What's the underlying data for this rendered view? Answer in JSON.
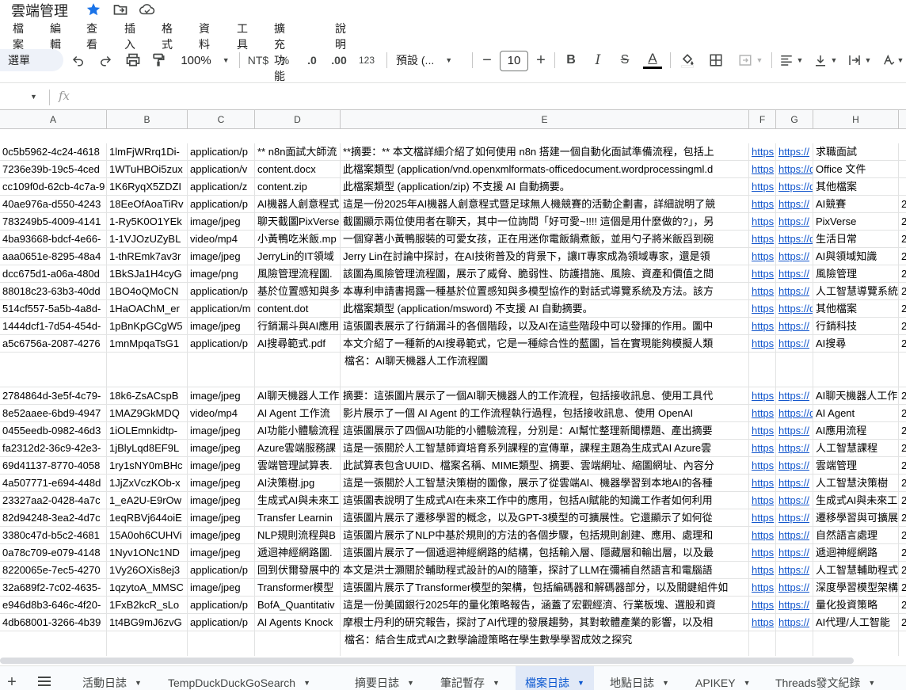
{
  "title": "雲端管理",
  "menu": [
    "檔案",
    "編輯",
    "查看",
    "插入",
    "格式",
    "資料",
    "工具",
    "擴充功能",
    "說明"
  ],
  "toolbar": {
    "search": "選單",
    "zoom": "100%",
    "currency": "NT$",
    "percent": "%",
    "decrease_decimal": ".0",
    "increase_decimal": ".00",
    "number_format": "123",
    "font": "預設 (...",
    "font_size": "10",
    "bold": "B",
    "italic": "I",
    "strike": "S",
    "text_color_label": "A",
    "text_color": "#000000"
  },
  "formula_bar": {
    "fx": "fx",
    "value": ""
  },
  "columns": [
    "A",
    "B",
    "C",
    "D",
    "E",
    "F",
    "G",
    "H"
  ],
  "rows": [
    {
      "a": "0c5b5962-4c24-4618",
      "b": "1lmFjWRrq1Di-",
      "c": "application/p",
      "d": "** n8n面試大師流",
      "e": "**摘要：** 本文檔詳細介紹了如何使用 n8n 搭建一個自動化面試準備流程，包括上",
      "f": "https",
      "g": "https://",
      "h": "求職面試"
    },
    {
      "a": "7236e39b-19c5-4ced",
      "b": "1WTuHBOi5zux",
      "c": "application/v",
      "d": "content.docx",
      "e": "此檔案類型 (application/vnd.openxmlformats-officedocument.wordprocessingml.d",
      "f": "https",
      "g": "https://docs.",
      "h": "Office 文件"
    },
    {
      "a": "cc109f0d-62cb-4c7a-9",
      "b": "1K6RyqX5ZDZI",
      "c": "application/z",
      "d": "content.zip",
      "e": "此檔案類型 (application/zip) 不支援 AI 自動摘要。",
      "f": "https",
      "g": "https://drive.",
      "h": "其他檔案"
    },
    {
      "a": "40ae976a-d550-4243",
      "b": "18EeOfAoaTiRv",
      "c": "application/p",
      "d": "AI機器人創意程式",
      "e": "這是一份2025年AI機器人創意程式暨足球無人機競賽的活動企劃書，詳細說明了競",
      "f": "https",
      "g": "https://",
      "h": "AI競賽",
      "i": "2"
    },
    {
      "a": "783249b5-4009-4141",
      "b": "1-Ry5K0O1YEk",
      "c": "image/jpeg",
      "d": "聊天截圖PixVerse",
      "e": "截圖顯示兩位使用者在聊天，其中一位詢問「好可愛~!!!! 這個是用什麼做的?」，另",
      "f": "https",
      "g": "https://",
      "h": "PixVerse",
      "i": "2"
    },
    {
      "a": "4ba93668-bdcf-4e66-",
      "b": "1-1VJOzUZyBL",
      "c": "video/mp4",
      "d": "小黃鴨吃米飯.mp",
      "e": "一個穿著小黃鴨服裝的可愛女孩，正在用迷你電飯鍋煮飯，並用勺子將米飯舀到碗",
      "f": "https",
      "g": "https://drive.",
      "h": "生活日常",
      "i": "2"
    },
    {
      "a": "aaa0651e-8295-48a4",
      "b": "1-thREmk7av3r",
      "c": "image/jpeg",
      "d": "JerryLin的IT領域",
      "e": "Jerry Lin在討論中探討，在AI技術普及的背景下，讓IT專家成為領域專家，還是領",
      "f": "https",
      "g": "https://",
      "h": "AI與領域知識",
      "i": "2"
    },
    {
      "a": "dcc675d1-a06a-480d",
      "b": "1BkSJa1H4cyG",
      "c": "image/png",
      "d": "風險管理流程圖.",
      "e": "該圖為風險管理流程圖，展示了威脅、脆弱性、防護措施、風險、資產和價值之間",
      "f": "https",
      "g": "https://",
      "h": "風險管理",
      "i": "2"
    },
    {
      "a": "88018c23-63b3-40dd",
      "b": "1BO4oQMoCN",
      "c": "application/p",
      "d": "基於位置感知與多",
      "e": "本專利申請書揭露一種基於位置感知與多模型協作的對話式導覽系統及方法。該方",
      "f": "https",
      "g": "https://",
      "h": "人工智慧導覽系統",
      "i": "2"
    },
    {
      "a": "514cf557-5a5b-4a8d-",
      "b": "1HaOAChM_er",
      "c": "application/m",
      "d": "content.dot",
      "e": "此檔案類型 (application/msword) 不支援 AI 自動摘要。",
      "f": "https",
      "g": "https://docs.",
      "h": "其他檔案",
      "i": "2"
    },
    {
      "a": "1444dcf1-7d54-454d-",
      "b": "1pBnKpGCgW5",
      "c": "image/jpeg",
      "d": "行銷漏斗與AI應用",
      "e": "這張圖表展示了行銷漏斗的各個階段，以及AI在這些階段中可以發揮的作用。圖中",
      "f": "https",
      "g": "https://",
      "h": "行銷科技",
      "i": "2"
    },
    {
      "a": "a5c6756a-2087-4276",
      "b": "1mnMpqaTsG1",
      "c": "application/p",
      "d": "AI搜尋範式.pdf",
      "e": "本文介紹了一種新的AI搜尋範式，它是一種綜合性的藍圖，旨在實現能夠模擬人類",
      "f": "https",
      "g": "https://",
      "h": "AI搜尋",
      "i": "2"
    },
    {
      "a": "",
      "b": "",
      "c": "",
      "d": "",
      "e": "檔名：AI聊天機器人工作流程圖",
      "f": "",
      "g": "",
      "h": "",
      "tall": true
    },
    {
      "a": "2784864d-3e5f-4c79-",
      "b": "18k6-ZsACspB",
      "c": "image/jpeg",
      "d": "AI聊天機器人工作",
      "e": "摘要：這張圖片展示了一個AI聊天機器人的工作流程，包括接收訊息、使用工具代",
      "f": "https",
      "g": "https://",
      "h": "AI聊天機器人工作",
      "i": "2"
    },
    {
      "a": "8e52aaee-6bd9-4947",
      "b": "1MAZ9GkMDQ",
      "c": "video/mp4",
      "d": "AI Agent 工作流",
      "e": "影片展示了一個 AI Agent 的工作流程執行過程，包括接收訊息、使用 OpenAI",
      "f": "https",
      "g": "https://drive.",
      "h": "AI Agent",
      "i": "2"
    },
    {
      "a": "0455eedb-0982-46d3",
      "b": "1iOLEmnkidtp-",
      "c": "image/jpeg",
      "d": "AI功能小體驗流程",
      "e": "這張圖展示了四個AI功能的小體驗流程，分別是：AI幫忙整理新聞標題、產出摘要",
      "f": "https",
      "g": "https://",
      "h": "AI應用流程",
      "i": "2"
    },
    {
      "a": "fa2312d2-36c9-42e3-",
      "b": "1jBlyLqd8EF9L",
      "c": "image/jpeg",
      "d": "Azure雲端服務課",
      "e": "這是一張關於人工智慧師資培育系列課程的宣傳單，課程主題為生成式AI Azure雲",
      "f": "https",
      "g": "https://",
      "h": "人工智慧課程",
      "i": "2"
    },
    {
      "a": "69d41137-8770-4058",
      "b": "1ry1sNY0mBHc",
      "c": "image/jpeg",
      "d": "雲端管理試算表.",
      "e": "此試算表包含UUID、檔案名稱、MIME類型、摘要、雲端網址、縮圖網址、內容分",
      "f": "https",
      "g": "https://",
      "h": "雲端管理",
      "i": "2"
    },
    {
      "a": "4a507771-e694-448d",
      "b": "1JjZxVczKOb-x",
      "c": "image/jpeg",
      "d": "AI決策樹.jpg",
      "e": "這是一張關於人工智慧決策樹的圖像，展示了從雲端AI、機器學習到本地AI的各種",
      "f": "https",
      "g": "https://",
      "h": "人工智慧決策樹",
      "i": "2"
    },
    {
      "a": "23327aa2-0428-4a7c",
      "b": "1_eA2U-E9rOw",
      "c": "image/jpeg",
      "d": "生成式AI與未來工",
      "e": "這張圖表說明了生成式AI在未來工作中的應用，包括AI賦能的知識工作者如何利用",
      "f": "https",
      "g": "https://",
      "h": "生成式AI與未來工",
      "i": "2"
    },
    {
      "a": "82d94248-3ea2-4d7c",
      "b": "1eqRBVj644oiE",
      "c": "image/jpeg",
      "d": "Transfer Learnin",
      "e": "這張圖片展示了遷移學習的概念，以及GPT-3模型的可擴展性。它還顯示了如何從",
      "f": "https",
      "g": "https://",
      "h": "遷移學習與可擴展",
      "i": "2"
    },
    {
      "a": "3380c47d-b5c2-4681",
      "b": "15A0oh6CUHVi",
      "c": "image/jpeg",
      "d": "NLP規則流程與B",
      "e": "這張圖片展示了NLP中基於規則的方法的各個步驟，包括規則創建、應用、處理和",
      "f": "https",
      "g": "https://",
      "h": "自然語言處理",
      "i": "2"
    },
    {
      "a": "0a78c709-e079-4148",
      "b": "1Nyv1ONc1ND",
      "c": "image/jpeg",
      "d": "遞迴神經網路圖.",
      "e": "這張圖片展示了一個遞迴神經網路的結構，包括輸入層、隱藏層和輸出層，以及最",
      "f": "https",
      "g": "https://",
      "h": "遞迴神經網路",
      "i": "2"
    },
    {
      "a": "8220065e-7ec5-4270",
      "b": "1Vy26OXis8ej3",
      "c": "application/p",
      "d": "回到伏爾發展中的",
      "e": "本文是洪士灝關於輔助程式設計的AI的隨筆，探討了LLM在彌補自然語言和電腦語",
      "f": "https",
      "g": "https://",
      "h": "人工智慧輔助程式",
      "i": "2"
    },
    {
      "a": "32a689f2-7c02-4635-",
      "b": "1qzytoA_MMSC",
      "c": "image/jpeg",
      "d": "Transformer模型",
      "e": "這張圖片展示了Transformer模型的架構，包括編碼器和解碼器部分，以及關鍵組件如",
      "f": "https",
      "g": "https://",
      "h": "深度學習模型架構",
      "i": "2"
    },
    {
      "a": "e946d8b3-646c-4f20-",
      "b": "1FxB2kcR_sLo",
      "c": "application/p",
      "d": "BofA_Quantitativ",
      "e": "這是一份美國銀行2025年的量化策略報告，涵蓋了宏觀經濟、行業板塊、選股和資",
      "f": "https",
      "g": "https://",
      "h": "量化投資策略",
      "i": "2"
    },
    {
      "a": "4db68001-3266-4b39",
      "b": "1t4BG9mJ6zvG",
      "c": "application/p",
      "d": "AI Agents Knock",
      "e": "摩根士丹利的研究報告，探討了AI代理的發展趨勢，其對軟體產業的影響，以及相",
      "f": "https",
      "g": "https://",
      "h": "AI代理/人工智能",
      "i": "2"
    },
    {
      "a": "",
      "b": "",
      "c": "",
      "d": "",
      "e": "檔名：結合生成式AI之數學論證策略在學生數學學習成效之探究",
      "f": "",
      "g": "",
      "h": "",
      "tall": true
    }
  ],
  "sheet_tabs": [
    {
      "label": "活動日誌",
      "active": false
    },
    {
      "label": "TempDuckDuckGoSearch",
      "active": false
    },
    {
      "label": "摘要日誌",
      "active": false
    },
    {
      "label": "筆記暫存",
      "active": false
    },
    {
      "label": "檔案日誌",
      "active": true
    },
    {
      "label": "地點日誌",
      "active": false
    },
    {
      "label": "APIKEY",
      "active": false
    },
    {
      "label": "Threads發文紀錄",
      "active": false
    }
  ],
  "colors": {
    "link": "#1155cc",
    "active_tab_bg": "#e1e9f7",
    "active_tab_text": "#0b57d0",
    "star": "#1a73e8"
  }
}
